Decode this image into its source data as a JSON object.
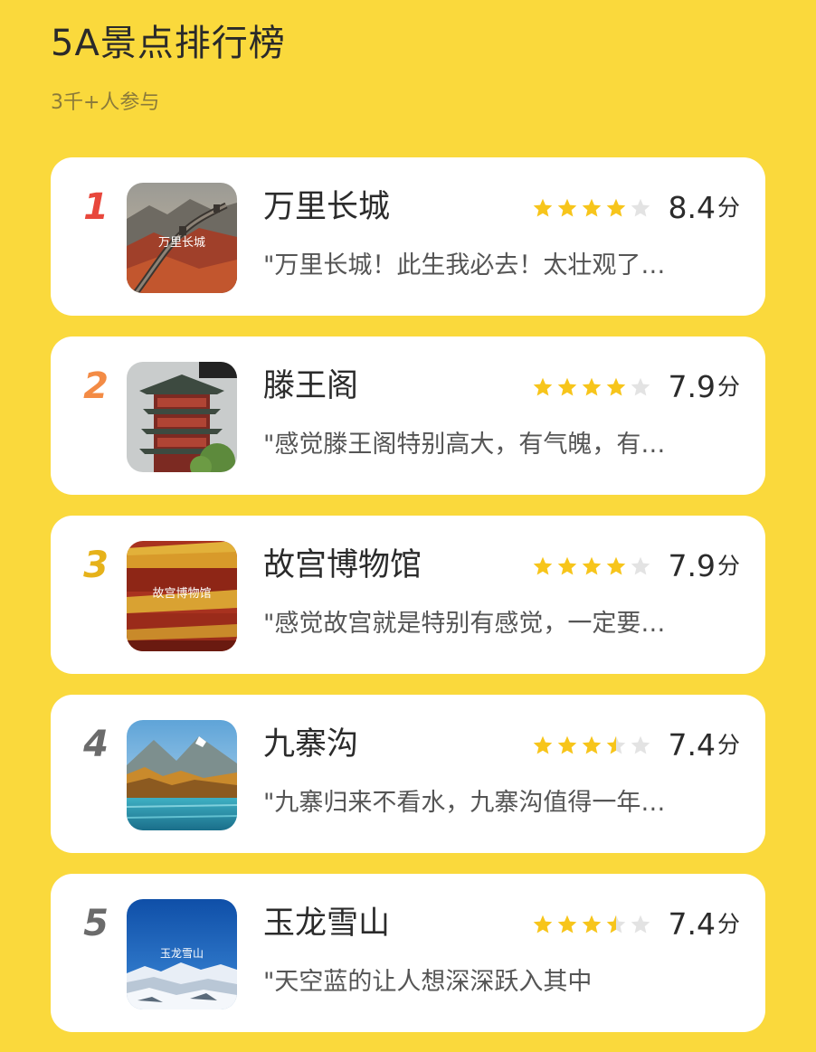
{
  "header": {
    "title": "5A景点排行榜",
    "subtitle": "3千+人参与"
  },
  "colors": {
    "background": "#FAD93C",
    "card": "#FFFFFF",
    "star_on": "#F7C51B",
    "star_off": "#E3E3E3",
    "rank_1": "#E8473C",
    "rank_2": "#F38B45",
    "rank_3": "#E6B21A",
    "rank_other": "#6B6B6B"
  },
  "ranking": [
    {
      "rank": "1",
      "rank_color": "#E8473C",
      "name": "万里长城",
      "image_caption": "万里长城",
      "image_icon": "great-wall-photo",
      "stars": 4,
      "score": "8.4",
      "unit": "分",
      "review": "\"万里长城！此生我必去！太壮观了…"
    },
    {
      "rank": "2",
      "rank_color": "#F38B45",
      "name": "滕王阁",
      "image_caption": "",
      "image_icon": "pavilion-photo",
      "stars": 4,
      "score": "7.9",
      "unit": "分",
      "review": "\"感觉滕王阁特别高大，有气魄，有…"
    },
    {
      "rank": "3",
      "rank_color": "#E6B21A",
      "name": "故宫博物馆",
      "image_caption": "故宫博物馆",
      "image_icon": "forbidden-city-photo",
      "stars": 4,
      "score": "7.9",
      "unit": "分",
      "review": "\"感觉故宫就是特别有感觉，一定要…"
    },
    {
      "rank": "4",
      "rank_color": "#6B6B6B",
      "name": "九寨沟",
      "image_caption": "",
      "image_icon": "mountain-lake-photo",
      "stars": 3.5,
      "score": "7.4",
      "unit": "分",
      "review": "\"九寨归来不看水，九寨沟值得一年…"
    },
    {
      "rank": "5",
      "rank_color": "#6B6B6B",
      "name": "玉龙雪山",
      "image_caption": "玉龙雪山",
      "image_icon": "snow-mountain-photo",
      "stars": 3.5,
      "score": "7.4",
      "unit": "分",
      "review": "\"天空蓝的让人想深深跃入其中"
    }
  ]
}
